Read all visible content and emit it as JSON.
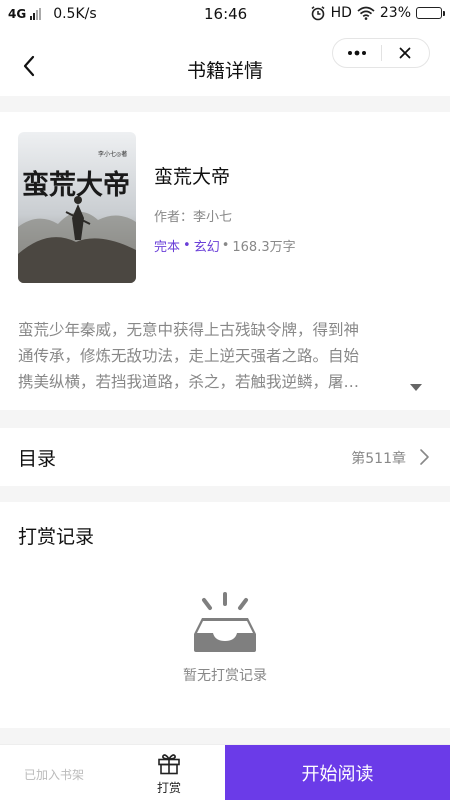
{
  "status_bar": {
    "network": "4G",
    "speed": "0.5K/s",
    "time": "16:46",
    "hd": "HD",
    "battery": "23%",
    "battery_level": 0.23
  },
  "nav": {
    "title": "书籍详情",
    "icons": {
      "back": "chevron-left-icon",
      "more": "more-dots-icon",
      "close": "close-icon"
    }
  },
  "book": {
    "cover_title": "蛮荒大帝",
    "cover_author": "李小七◎著",
    "title": "蛮荒大帝",
    "author": "作者：李小七",
    "status_tag": "完本",
    "genre_tag": "玄幻",
    "word_count": "168.3万字",
    "description_lines": [
      "蛮荒少年秦威，无意中获得上古残缺令牌，得到神",
      "通传承，修炼无敌功法，走上逆天强者之路。自始",
      "携美纵横，若挡我道路，杀之，若触我逆鳞，屠…"
    ]
  },
  "catalog": {
    "label": "目录",
    "latest_chapter": "第511章"
  },
  "reward": {
    "title": "打赏记录",
    "empty_text": "暂无打赏记录",
    "empty_icon": "empty-inbox-icon"
  },
  "bottom": {
    "shelf_label": "已加入书架",
    "tip_label": "打赏",
    "tip_icon": "gift-icon",
    "read_label": "开始阅读"
  },
  "colors": {
    "accent": "#6b3be8",
    "tag": "#6a3fd8",
    "muted_text": "#888888",
    "background": "#f5f5f5"
  }
}
